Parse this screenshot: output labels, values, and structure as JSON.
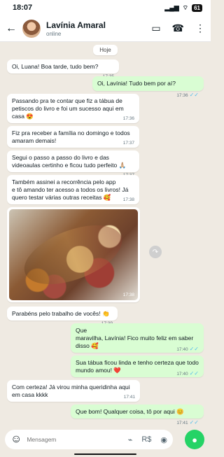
{
  "status": {
    "time": "18:07",
    "battery": "61"
  },
  "header": {
    "contact_name": "Lavínia Amaral",
    "contact_status": "online"
  },
  "chat": {
    "date_chip": "Hoje",
    "messages": [
      {
        "text": "Oi, Luana! Boa tarde, tudo bem?",
        "time": "17:35",
        "direction": "in"
      },
      {
        "text": "Oi, Lavínia! Tudo bem por aí?",
        "time": "17:36",
        "direction": "out"
      },
      {
        "text": "Passando pra te contar que fiz a tábua de petiscos do livro e foi um sucesso aqui em casa 😍",
        "time": "17:36",
        "direction": "in"
      },
      {
        "text": "Fiz pra receber a família no domingo e todos amaram demais!",
        "time": "17:37",
        "direction": "in"
      },
      {
        "text": "Segui o passo a passo do livro e das videoaulas certinho e ficou tudo perfeito 🙏🏼",
        "time": "17:37",
        "direction": "in"
      },
      {
        "text": "Também assinei a recorrência pelo app e tô amando ter acesso a todos os livros! Já quero testar várias outras receitas 🥰",
        "time": "17:38",
        "direction": "in"
      },
      {
        "image": "charcuterie-board",
        "time": "17:38",
        "direction": "in"
      },
      {
        "text": "Parabéns pelo trabalho de vocês! 👏",
        "time": "17:39",
        "direction": "in"
      },
      {
        "text": "Que maravilha, Lavínia! Fico muito feliz em saber disso 🥰",
        "time": "17:40",
        "direction": "out"
      },
      {
        "text": "Sua tábua ficou linda e tenho certeza que todo mundo amou! ❤️",
        "time": "17:40",
        "direction": "out"
      },
      {
        "text": "Com certeza! Já virou minha queridinha aqui em casa kkkk",
        "time": "17:41",
        "direction": "in"
      },
      {
        "text": "Que bom! Qualquer coisa, tô por aqui 😊",
        "time": "17:41",
        "direction": "out"
      }
    ]
  },
  "composer": {
    "placeholder": "Mensagem"
  },
  "colors": {
    "chat_background": "#efeae2",
    "incoming": "#ffffff",
    "outgoing": "#d9fdd3",
    "read_ticks": "#53bdeb",
    "accent": "#25d366"
  },
  "icons": {
    "back": "back-arrow-icon",
    "video": "video-call-icon",
    "phone": "phone-icon",
    "menu": "more-options-icon",
    "emoji": "emoji-icon",
    "attach": "paperclip-icon",
    "payment": "currency-icon",
    "camera": "camera-icon",
    "mic": "microphone-icon",
    "share": "forward-icon"
  }
}
